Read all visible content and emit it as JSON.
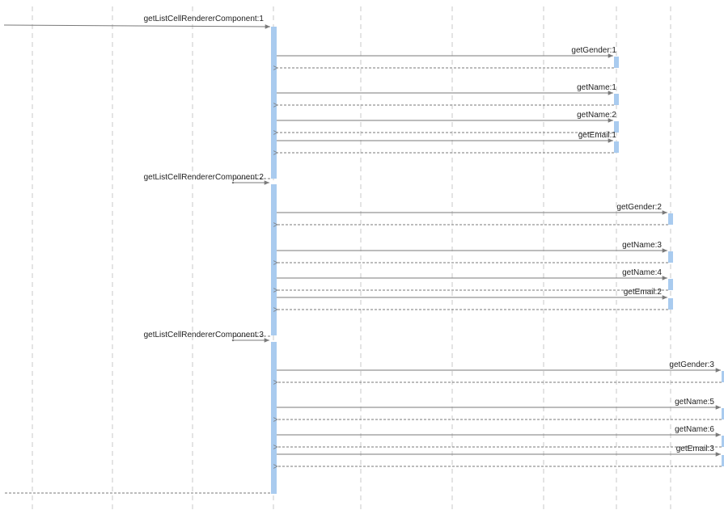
{
  "colors": {
    "lifeline": "#c8c8c8",
    "activation": "#a9cbef",
    "arrow": "#7a7a7a",
    "text": "#222222"
  },
  "lifeline_count": 9,
  "messages": [
    {
      "group": 1,
      "call": "getListCellRendererComponent:1"
    },
    {
      "group": 1,
      "call": "getGender:1"
    },
    {
      "group": 1,
      "call": "getName:1"
    },
    {
      "group": 1,
      "call": "getName:2"
    },
    {
      "group": 1,
      "call": "getEmail:1"
    },
    {
      "group": 2,
      "call": "getListCellRendererComponent:2"
    },
    {
      "group": 2,
      "call": "getGender:2"
    },
    {
      "group": 2,
      "call": "getName:3"
    },
    {
      "group": 2,
      "call": "getName:4"
    },
    {
      "group": 2,
      "call": "getEmail:2"
    },
    {
      "group": 3,
      "call": "getListCellRendererComponent:3"
    },
    {
      "group": 3,
      "call": "getGender:3"
    },
    {
      "group": 3,
      "call": "getName:5"
    },
    {
      "group": 3,
      "call": "getName:6"
    },
    {
      "group": 3,
      "call": "getEmail:3"
    }
  ]
}
